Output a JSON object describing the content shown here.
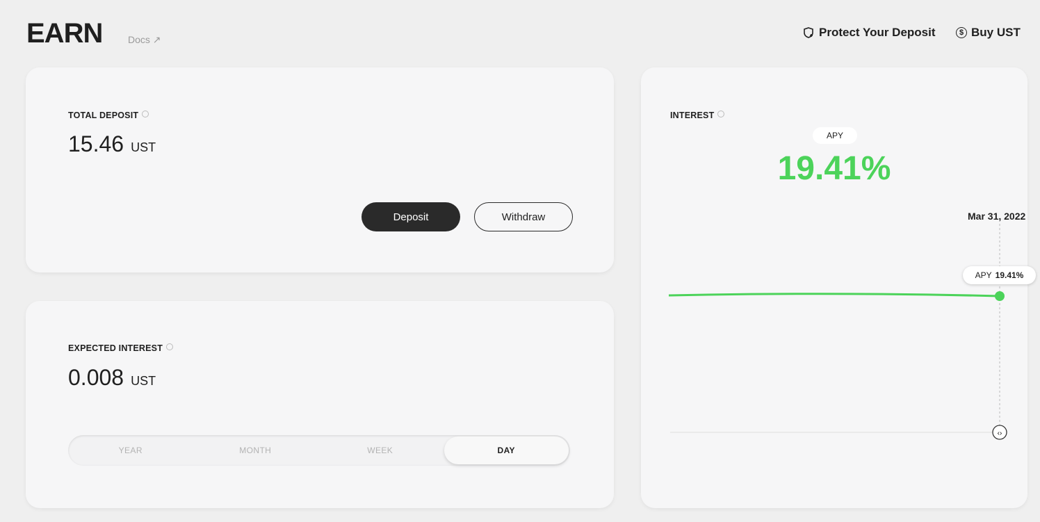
{
  "header": {
    "logo": "EARN",
    "docs": "Docs",
    "protect": "Protect Your Deposit",
    "buy": "Buy UST"
  },
  "total_deposit": {
    "label": "TOTAL DEPOSIT",
    "value": "15.46",
    "unit": "UST",
    "deposit": "Deposit",
    "withdraw": "Withdraw"
  },
  "expected_interest": {
    "label": "EXPECTED INTEREST",
    "value": "0.008",
    "unit": "UST",
    "tabs": [
      "YEAR",
      "MONTH",
      "WEEK",
      "DAY"
    ],
    "selected": "DAY"
  },
  "interest": {
    "label": "INTEREST",
    "apy_badge": "APY",
    "apy_value": "19.41%",
    "date": "Mar 31, 2022",
    "tooltip_label": "APY",
    "tooltip_value": "19.41%",
    "accent": "#4cd35a"
  },
  "chart_data": {
    "type": "line",
    "series": [
      {
        "values": [
          19.41,
          19.41,
          19.41,
          19.41,
          19.41
        ]
      }
    ],
    "x_last": "Mar 31, 2022"
  }
}
